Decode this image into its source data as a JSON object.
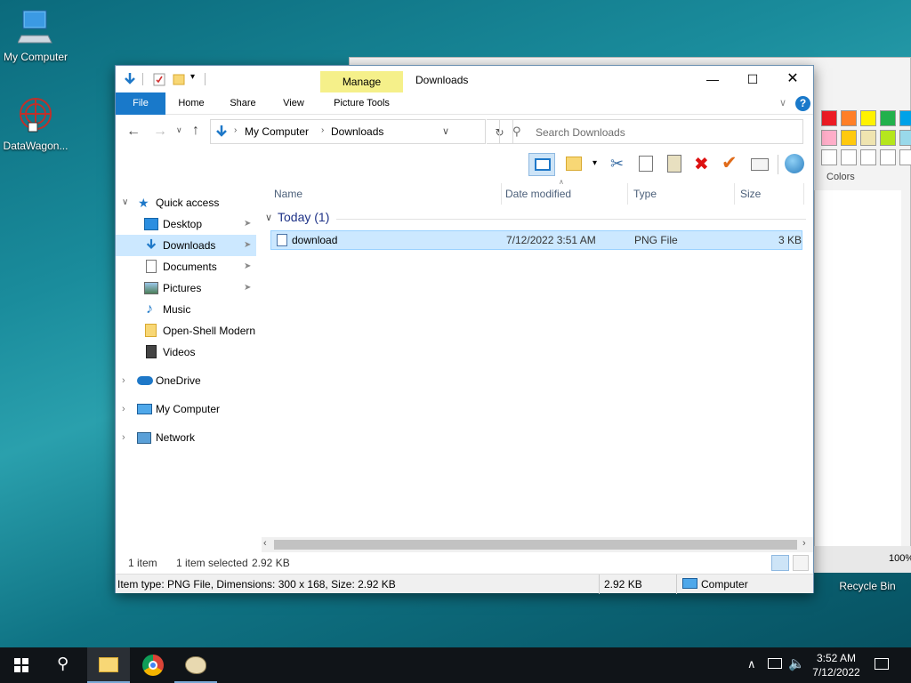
{
  "desktop": {
    "icons": [
      {
        "label": "My Computer"
      },
      {
        "label": "DataWagon..."
      },
      {
        "label": "Recycle Bin"
      }
    ]
  },
  "paint": {
    "colors_label": "Colors",
    "zoom": "100%"
  },
  "explorer": {
    "title": "Downloads",
    "context_tab_header": "Manage",
    "tabs": {
      "file": "File",
      "home": "Home",
      "share": "Share",
      "view": "View",
      "picture_tools": "Picture Tools"
    },
    "address": {
      "crumbs": [
        "My Computer",
        "Downloads"
      ]
    },
    "search": {
      "placeholder": "Search Downloads"
    },
    "nav": {
      "quick_access": "Quick access",
      "items": [
        {
          "label": "Desktop",
          "pinned": true
        },
        {
          "label": "Downloads",
          "pinned": true
        },
        {
          "label": "Documents",
          "pinned": true
        },
        {
          "label": "Pictures",
          "pinned": true
        },
        {
          "label": "Music",
          "pinned": false
        },
        {
          "label": "Open-Shell Modern",
          "pinned": false
        },
        {
          "label": "Videos",
          "pinned": false
        }
      ],
      "roots": [
        "OneDrive",
        "My Computer",
        "Network"
      ]
    },
    "columns": [
      "Name",
      "Date modified",
      "Type",
      "Size"
    ],
    "group": "Today (1)",
    "files": [
      {
        "name": "download",
        "date": "7/12/2022 3:51 AM",
        "type": "PNG File",
        "size": "3 KB"
      }
    ],
    "status": {
      "count": "1 item",
      "selected": "1 item selected",
      "selected_size": "2.92 KB"
    },
    "details": {
      "info": "Item type: PNG File, Dimensions: 300 x 168, Size: 2.92 KB",
      "size": "2.92 KB",
      "location": "Computer"
    }
  },
  "taskbar": {
    "time": "3:52 AM",
    "date": "7/12/2022"
  }
}
